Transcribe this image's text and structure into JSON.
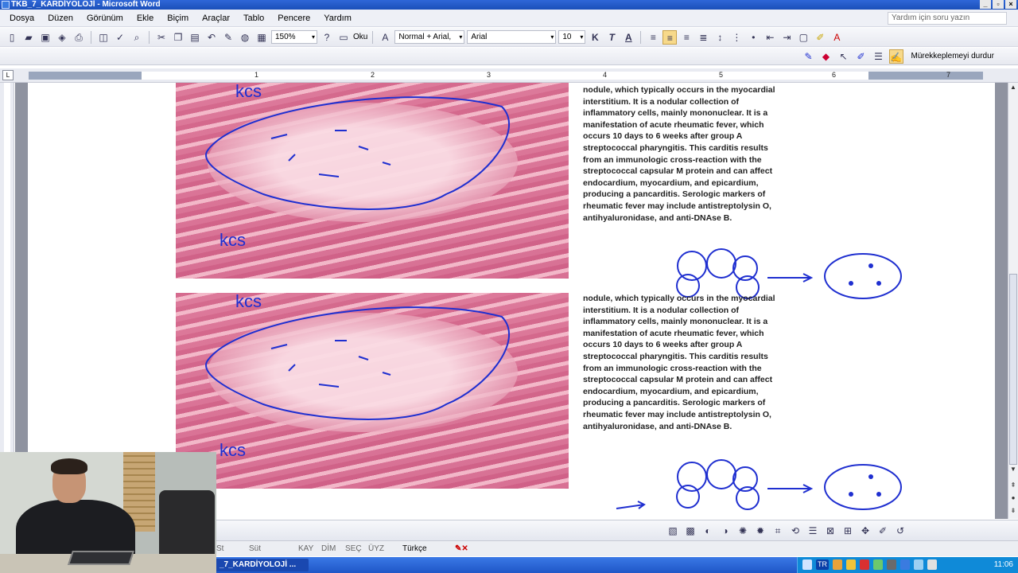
{
  "window": {
    "title": "TKB_7_KARDİYOLOJİ - Microsoft Word",
    "controls": [
      "_",
      "▫",
      "×"
    ]
  },
  "menu": {
    "items": [
      "Dosya",
      "Düzen",
      "Görünüm",
      "Ekle",
      "Biçim",
      "Araçlar",
      "Tablo",
      "Pencere",
      "Yardım"
    ],
    "help_placeholder": "Yardım için soru yazın"
  },
  "toolbar": {
    "zoom": "150%",
    "read_label": "Oku",
    "style": "Normal + Arial,",
    "font": "Arial",
    "size": "10",
    "bold": "K",
    "italic": "T",
    "underline": "A"
  },
  "ink_toolbar": {
    "stop_label": "Mürekkeplemeyi durdur"
  },
  "ruler": {
    "numbers": [
      "1",
      "2",
      "3",
      "4",
      "5",
      "6",
      "7"
    ]
  },
  "document": {
    "paragraph": "nodule, which typically occurs in the myocardial\ninterstitium. It is a nodular collection of\ninflammatory cells, mainly mononuclear. It is a\nmanifestation of acute rheumatic fever, which\noccurs 10 days to 6 weeks after group A\nstreptococcal pharyngitis. This carditis results\nfrom an immunologic cross-reaction with the\nstreptococcal capsular M protein and can affect\nendocardium, myocardium, and epicardium,\nproducing a pancarditis. Serologic markers of\nrheumatic fever may include antistreptolysin O,\nantihyaluronidase, and anti-DNAse B.",
    "ink_label": "kcs"
  },
  "status": {
    "page_info": "St",
    "col": "Süt",
    "rec": "KAY",
    "trk": "DİM",
    "ext": "SEÇ",
    "ovr": "ÜYZ",
    "language": "Türkçe"
  },
  "taskbar": {
    "task_label": "_7_KARDİYOLOJİ ...",
    "lang": "TR",
    "clock": "11:06"
  }
}
